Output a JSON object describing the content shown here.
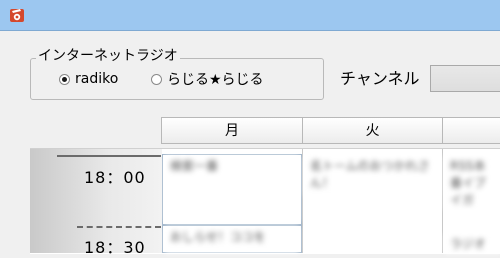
{
  "window": {
    "icon": "app-logo-icon"
  },
  "source_group": {
    "title": "インターネットラジオ",
    "options": [
      {
        "label": "radiko",
        "checked": true
      },
      {
        "label": "らじる★らじる",
        "checked": false
      }
    ]
  },
  "channel": {
    "label": "チャンネル",
    "value": ""
  },
  "schedule": {
    "days": [
      "月",
      "火",
      ""
    ],
    "times": [
      "18：00",
      "18：30"
    ],
    "programs": [
      {
        "text": "検索一番"
      },
      {
        "text": "名トームのおつかれさん！"
      },
      {
        "text": "RSS本番イブイガ"
      },
      {
        "text": "おしらせ！ココを"
      },
      {
        "text": "ラジオ"
      }
    ]
  }
}
